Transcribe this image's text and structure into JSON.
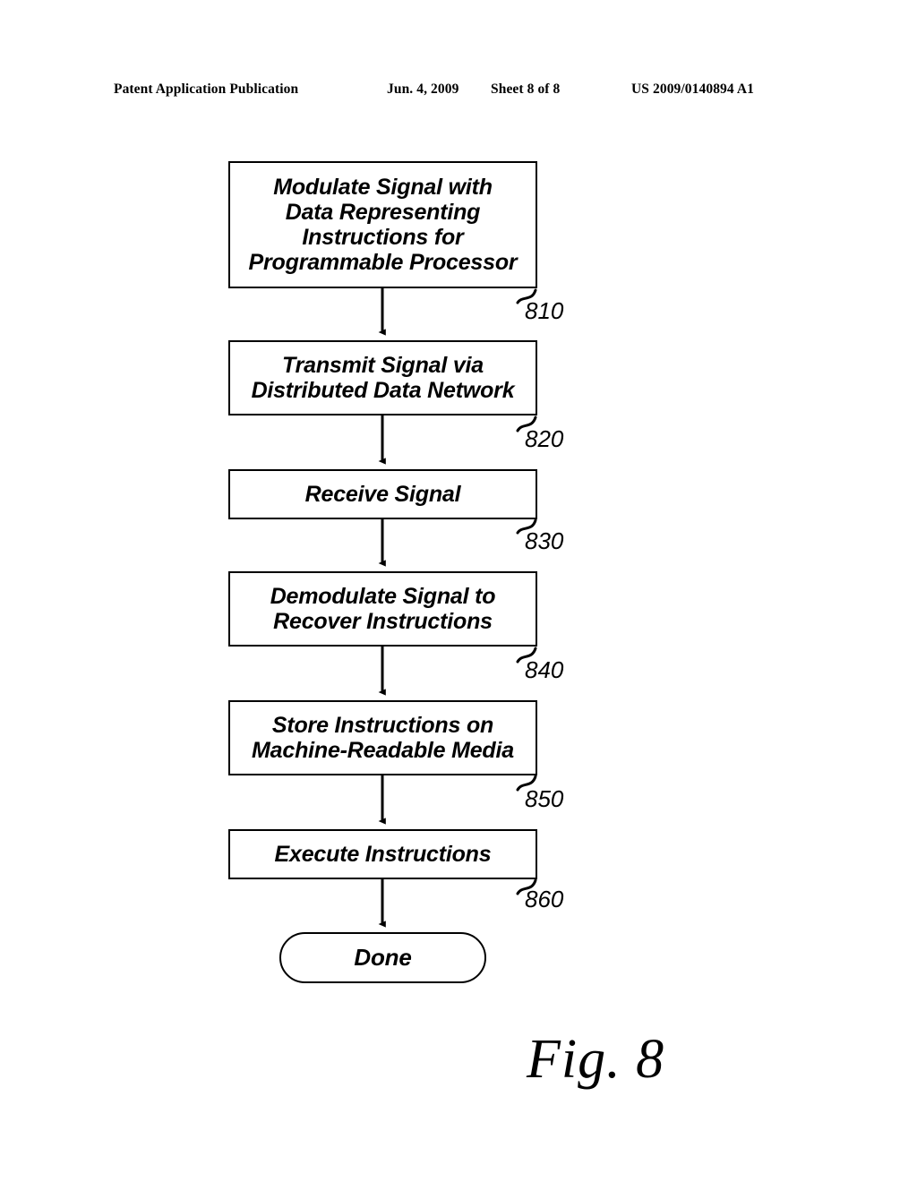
{
  "header": {
    "publication": "Patent Application Publication",
    "date": "Jun. 4, 2009",
    "sheet": "Sheet 8 of 8",
    "patent_number": "US 2009/0140894 A1"
  },
  "figure": {
    "caption": "Fig. 8",
    "line_color": "#000000",
    "background": "#ffffff"
  },
  "flowchart": {
    "nodes": [
      {
        "id": "810",
        "shape": "rectangle",
        "text": "Modulate Signal with\nData Representing\nInstructions for\nProgrammable Processor",
        "ref": "810"
      },
      {
        "id": "820",
        "shape": "rectangle",
        "text": "Transmit Signal via\nDistributed Data Network",
        "ref": "820"
      },
      {
        "id": "830",
        "shape": "rectangle",
        "text": "Receive Signal",
        "ref": "830"
      },
      {
        "id": "840",
        "shape": "rectangle",
        "text": "Demodulate Signal to\nRecover Instructions",
        "ref": "840"
      },
      {
        "id": "850",
        "shape": "rectangle",
        "text": "Store Instructions on\nMachine-Readable Media",
        "ref": "850"
      },
      {
        "id": "860",
        "shape": "rectangle",
        "text": "Execute Instructions",
        "ref": "860"
      },
      {
        "id": "done",
        "shape": "stadium",
        "text": "Done",
        "ref": ""
      }
    ],
    "connectors": [
      {
        "from": "810",
        "to": "820",
        "type": "arrow-down"
      },
      {
        "from": "820",
        "to": "830",
        "type": "arrow-down"
      },
      {
        "from": "830",
        "to": "840",
        "type": "arrow-down"
      },
      {
        "from": "840",
        "to": "850",
        "type": "arrow-down"
      },
      {
        "from": "850",
        "to": "860",
        "type": "arrow-down"
      },
      {
        "from": "860",
        "to": "done",
        "type": "arrow-down"
      }
    ]
  }
}
